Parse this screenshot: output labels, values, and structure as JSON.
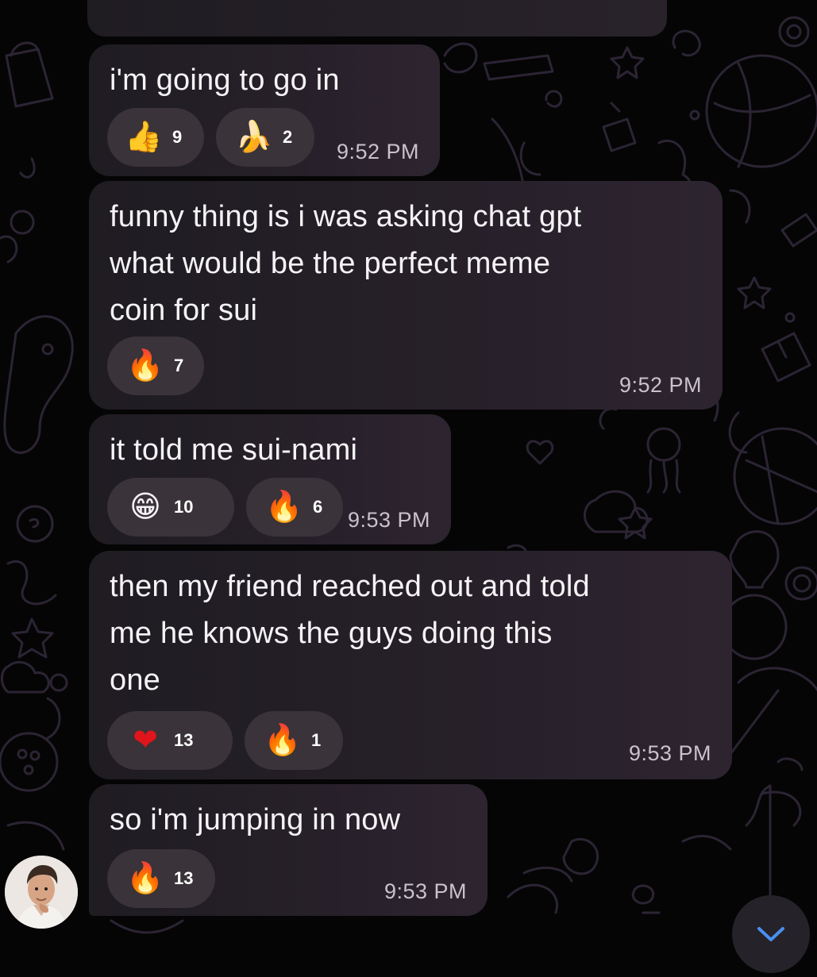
{
  "messages": [
    {
      "text": "i'm going to go in",
      "time": "9:52 PM",
      "reactions": [
        {
          "emoji": "👍",
          "icon": "thumbs-up-icon",
          "count": "9"
        },
        {
          "emoji": "🍌",
          "icon": "banana-icon",
          "count": "2"
        }
      ]
    },
    {
      "text": "funny thing is i was asking chat gpt\nwhat would be the perfect meme\ncoin for sui",
      "time": "9:52 PM",
      "reactions": [
        {
          "emoji": "🔥",
          "icon": "fire-icon",
          "count": "7"
        }
      ]
    },
    {
      "text": "it told me sui-nami",
      "time": "9:53 PM",
      "reactions": [
        {
          "emoji": "😁",
          "icon": "grinning-face-icon",
          "count": "10"
        },
        {
          "emoji": "🔥",
          "icon": "fire-icon",
          "count": "6"
        }
      ]
    },
    {
      "text": "then my friend reached out and told\nme he knows the guys doing this\none",
      "time": "9:53 PM",
      "reactions": [
        {
          "emoji": "❤",
          "icon": "heart-icon",
          "count": "13"
        },
        {
          "emoji": "🔥",
          "icon": "fire-icon",
          "count": "1"
        }
      ]
    },
    {
      "text": "so i'm jumping in now",
      "time": "9:53 PM",
      "reactions": [
        {
          "emoji": "🔥",
          "icon": "fire-icon",
          "count": "13"
        }
      ]
    }
  ],
  "colors": {
    "background": "#050505",
    "bubble": "#272029",
    "reaction_pill": "#3a3339",
    "text": "#f5f3f6",
    "timestamp": "#c9c2cb"
  }
}
